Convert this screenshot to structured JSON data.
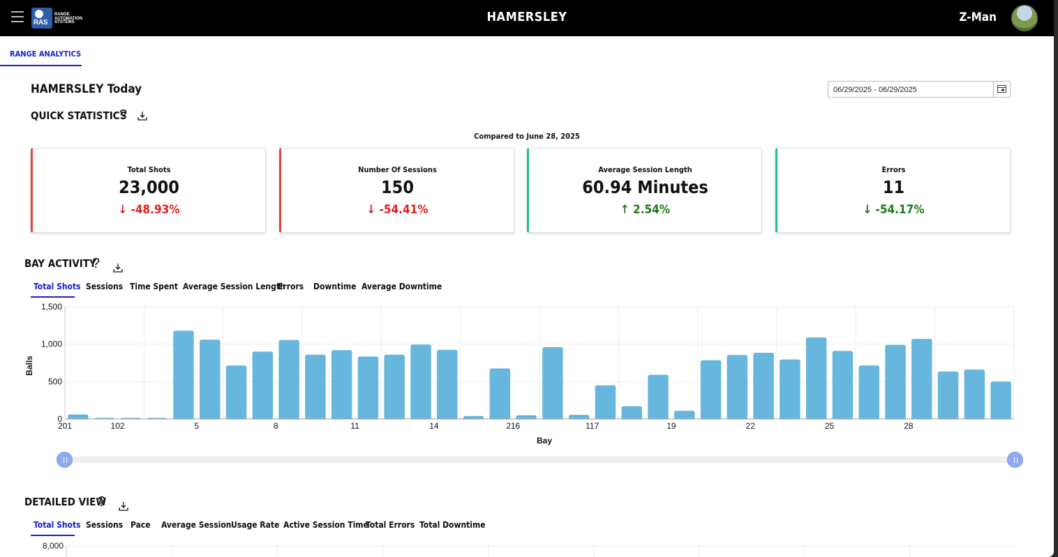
{
  "header": {
    "menu_icon": "hamburger-menu-icon",
    "logo_text": "RAS",
    "logo_lines": [
      "RANGE",
      "AUTOMATION",
      "SYSTEMS"
    ],
    "title": "HAMERSLEY",
    "user_name": "Z-Man"
  },
  "nav": {
    "active_tab": "RANGE ANALYTICS"
  },
  "page": {
    "heading": "HAMERSLEY Today",
    "date_range": "06/29/2025 - 06/29/2025"
  },
  "quick_stats": {
    "title": "QUICK STATISTICS",
    "compared": "Compared to June 28, 2025",
    "cards": [
      {
        "label": "Total Shots",
        "value": "23,000",
        "change": "-48.93%",
        "direction": "down",
        "status_color": "#e0403a"
      },
      {
        "label": "Number Of Sessions",
        "value": "150",
        "change": "-54.41%",
        "direction": "down",
        "status_color": "#e0403a"
      },
      {
        "label": "Average Session Length",
        "value": "60.94 Minutes",
        "change": "2.54%",
        "direction": "up",
        "status_color": "#18c08a"
      },
      {
        "label": "Errors",
        "value": "11",
        "change": "-54.17%",
        "direction": "down",
        "status_color": "#18c08a"
      }
    ]
  },
  "bay_activity": {
    "title": "BAY ACTIVITY",
    "tabs": [
      "Total Shots",
      "Sessions",
      "Time Spent",
      "Average Session Length",
      "Errors",
      "Downtime",
      "Average Downtime"
    ],
    "active_tab": "Total Shots"
  },
  "detailed_view": {
    "title": "DETAILED VIEW",
    "tabs": [
      "Total Shots",
      "Sessions",
      "Pace",
      "Average Session",
      "Usage Rate",
      "Active Session Time",
      "Total Errors",
      "Total Downtime"
    ],
    "active_tab": "Total Shots",
    "y_top_label": "8,000"
  },
  "chart_data": {
    "type": "bar",
    "xlabel": "Bay",
    "ylabel": "Balls",
    "ylim": [
      0,
      1500
    ],
    "yticks": [
      "0",
      "500",
      "1,000",
      "1,500"
    ],
    "grid": true,
    "bar_color": "#67b6de",
    "categories": [
      "201",
      "",
      "102",
      "",
      "",
      "5",
      "",
      "",
      "8",
      "",
      "",
      "11",
      "",
      "",
      "14",
      "",
      "",
      "216",
      "",
      "",
      "117",
      "",
      "",
      "19",
      "",
      "",
      "22",
      "",
      "",
      "25",
      "",
      "",
      "28",
      "",
      ""
    ],
    "values": [
      60,
      15,
      15,
      15,
      1180,
      1060,
      715,
      900,
      1055,
      860,
      920,
      835,
      860,
      995,
      925,
      40,
      675,
      50,
      960,
      55,
      450,
      170,
      590,
      110,
      785,
      855,
      885,
      795,
      1090,
      910,
      715,
      990,
      1070,
      635,
      660,
      500
    ]
  }
}
